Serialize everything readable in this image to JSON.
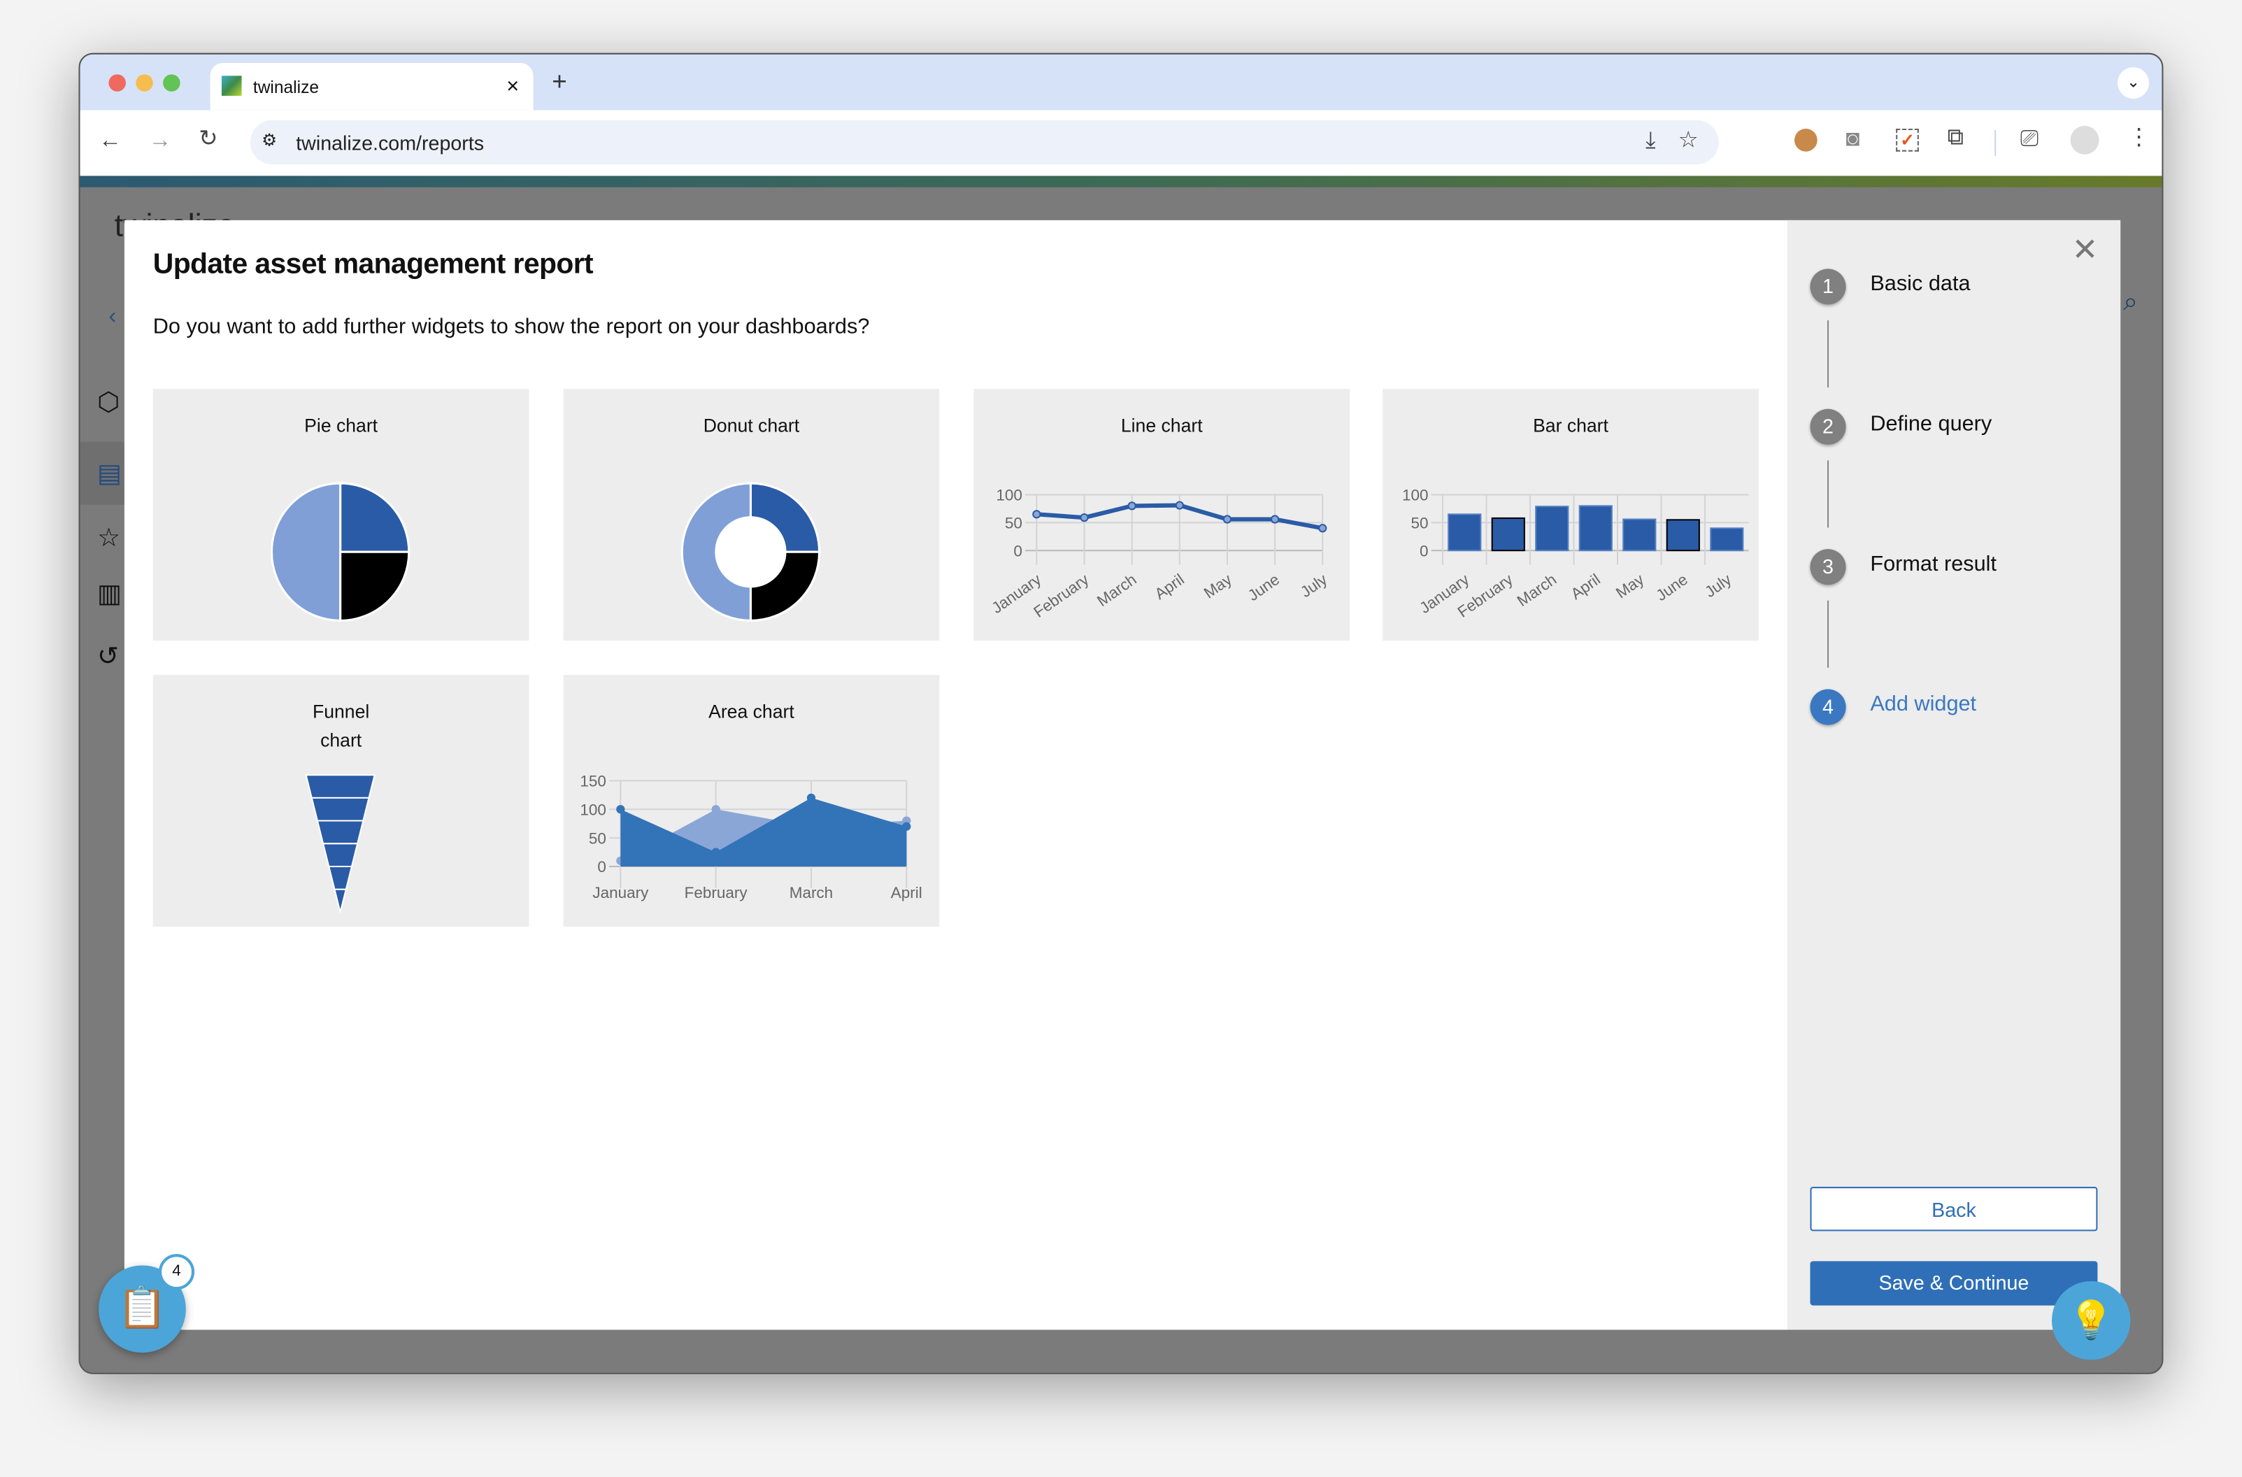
{
  "browser": {
    "tab_title": "twinalize",
    "url": "twinalize.com/reports",
    "new_tab": "+",
    "close_tab": "×"
  },
  "app": {
    "logo_text": "twinalize"
  },
  "modal": {
    "title": "Update asset management report",
    "question": "Do you want to add further widgets to show the report on your dashboards?",
    "widgets": [
      {
        "label": "Pie chart"
      },
      {
        "label": "Donut chart"
      },
      {
        "label": "Line chart"
      },
      {
        "label": "Bar chart"
      },
      {
        "label": "Funnel\nchart"
      },
      {
        "label": "Area chart"
      }
    ]
  },
  "wizard": {
    "steps": [
      {
        "number": "1",
        "label": "Basic data",
        "active": false
      },
      {
        "number": "2",
        "label": "Define query",
        "active": false
      },
      {
        "number": "3",
        "label": "Format result",
        "active": false
      },
      {
        "number": "4",
        "label": "Add widget",
        "active": true
      }
    ],
    "back_label": "Back",
    "save_label": "Save & Continue"
  },
  "floating": {
    "badge_count": "4"
  },
  "colors": {
    "accent": "#2f6fb7",
    "series_dark": "#2a5ba6",
    "series_light": "#8aa6d6",
    "active_step": "#3a78c2"
  },
  "chart_data": [
    {
      "type": "pie",
      "title": "Pie chart",
      "values": [
        25,
        25,
        50
      ],
      "colors": [
        "#2a5ba6",
        "#000000",
        "#809fd7"
      ]
    },
    {
      "type": "pie",
      "title": "Donut chart",
      "donut": true,
      "values": [
        25,
        25,
        50
      ],
      "colors": [
        "#2a5ba6",
        "#000000",
        "#809fd7"
      ]
    },
    {
      "type": "line",
      "title": "Line chart",
      "categories": [
        "January",
        "February",
        "March",
        "April",
        "May",
        "June",
        "July"
      ],
      "values": [
        65,
        59,
        80,
        81,
        56,
        56,
        40
      ],
      "yticks": [
        "0",
        "50",
        "100"
      ],
      "ylim": [
        0,
        100
      ],
      "grid": true
    },
    {
      "type": "bar",
      "title": "Bar chart",
      "categories": [
        "January",
        "February",
        "March",
        "April",
        "May",
        "June",
        "July"
      ],
      "values": [
        65,
        58,
        79,
        80,
        56,
        55,
        40
      ],
      "yticks": [
        "0",
        "50",
        "100"
      ],
      "ylim": [
        0,
        100
      ],
      "grid": true
    },
    {
      "type": "funnel",
      "title": "Funnel chart",
      "stages": 6
    },
    {
      "type": "area",
      "title": "Area chart",
      "categories": [
        "January",
        "February",
        "March",
        "April"
      ],
      "series": [
        {
          "values": [
            10,
            100,
            70,
            80
          ]
        },
        {
          "values": [
            100,
            25,
            120,
            70
          ]
        }
      ],
      "yticks": [
        "0",
        "50",
        "100",
        "150"
      ],
      "ylim": [
        0,
        150
      ],
      "grid": true
    }
  ]
}
